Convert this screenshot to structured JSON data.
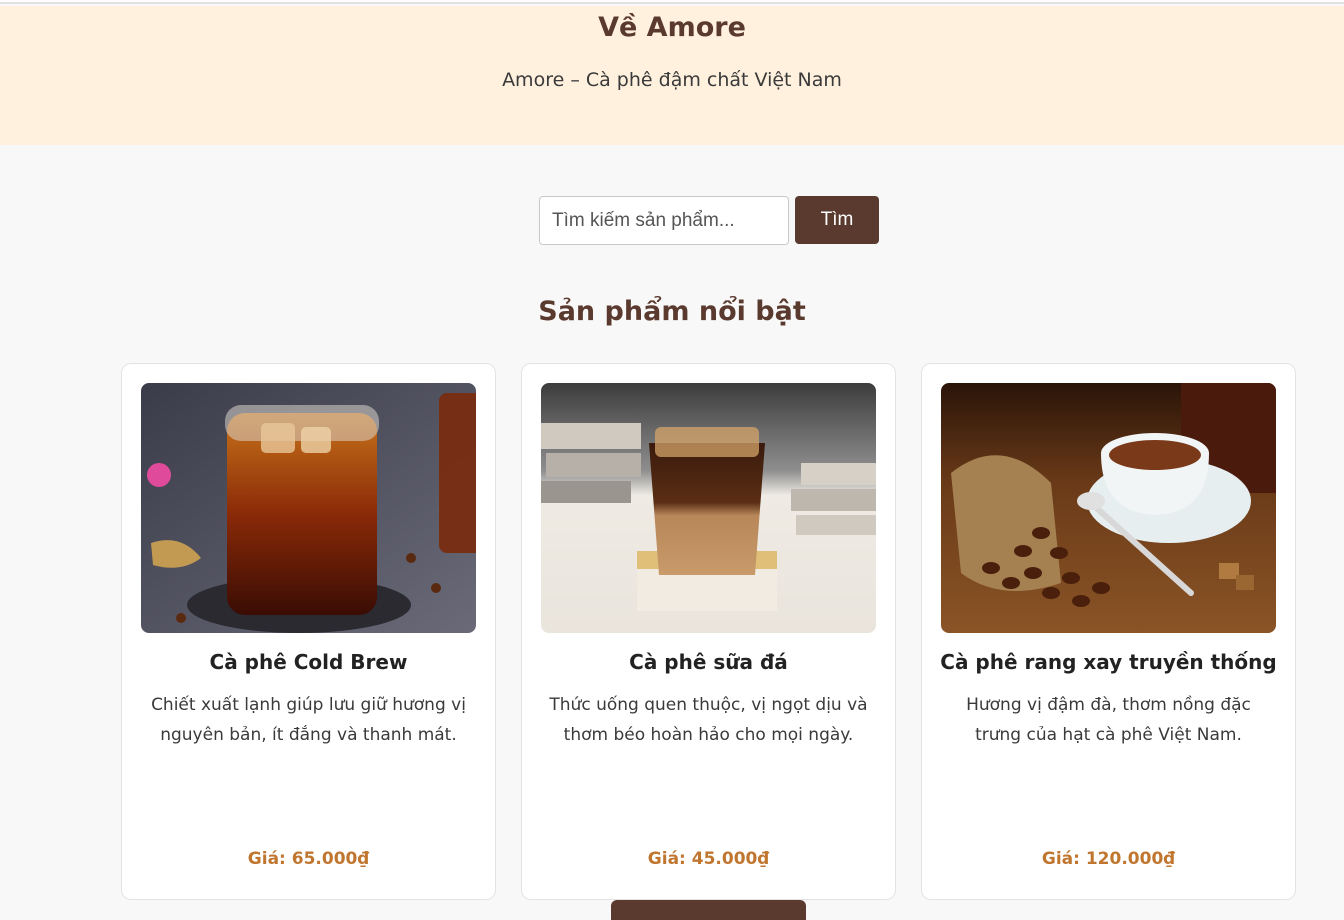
{
  "about": {
    "title": "Về Amore",
    "tagline": "Amore – Cà phê đậm chất Việt Nam"
  },
  "search": {
    "placeholder": "Tìm kiếm sản phẩm...",
    "button_label": "Tìm"
  },
  "featured": {
    "title": "Sản phẩm nổi bật",
    "products": [
      {
        "name": "Cà phê Cold Brew",
        "description": "Chiết xuất lạnh giúp lưu giữ hương vị nguyên bản, ít đắng và thanh mát.",
        "price": "Giá: 65.000₫",
        "image": "cold-brew-glass-image"
      },
      {
        "name": "Cà phê sữa đá",
        "description": "Thức uống quen thuộc, vị ngọt dịu và thơm béo hoàn hảo cho mọi ngày.",
        "price": "Giá: 45.000₫",
        "image": "iced-milk-coffee-image"
      },
      {
        "name": "Cà phê rang xay truyền thống",
        "description": "Hương vị đậm đà, thơm nồng đặc trưng của hạt cà phê Việt Nam.",
        "price": "Giá: 120.000₫",
        "image": "coffee-cup-beans-image"
      }
    ]
  },
  "colors": {
    "brand_brown": "#5a3a2e",
    "hero_background": "#fff1de",
    "price_color": "#c0762f"
  }
}
